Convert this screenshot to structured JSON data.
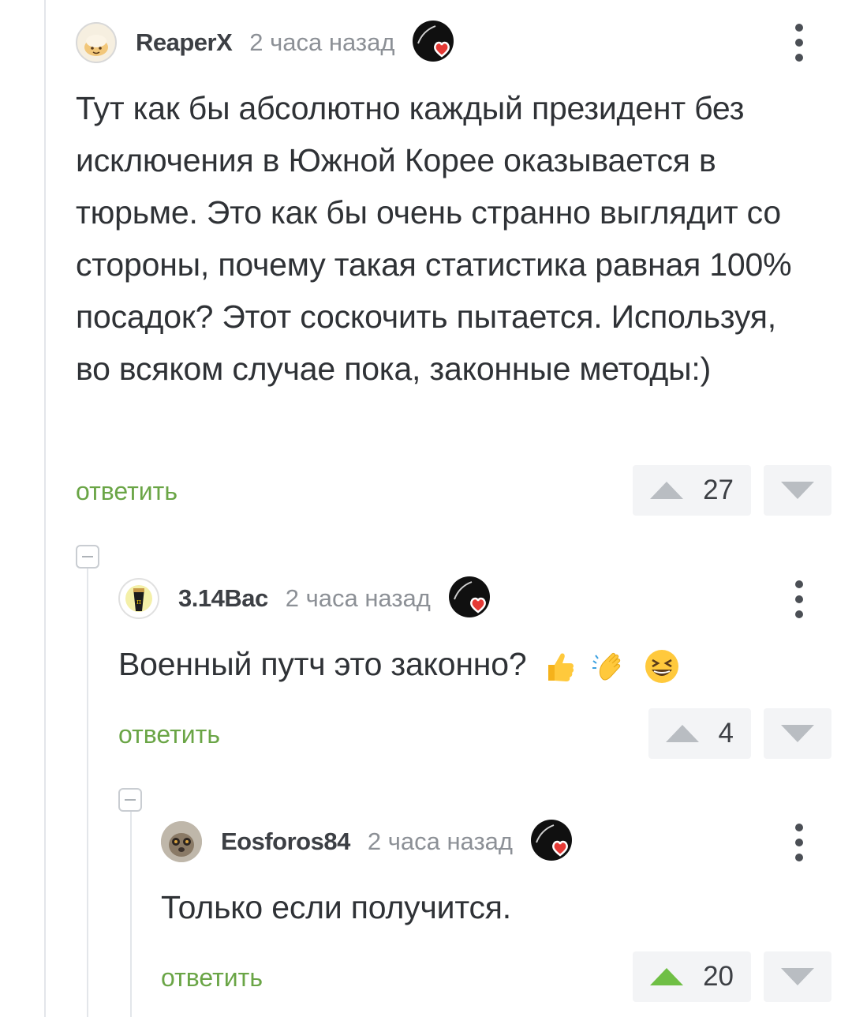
{
  "comments": [
    {
      "username": "ReaperX",
      "time": "2 часа назад",
      "avatar_icon": "pastry-avatar-icon",
      "text": "Тут как бы абсолютно каждый президент без исключения в Южной Корее оказывается в тюрьме. Это как бы очень странно выглядит со стороны, почему такая статистика равная 100% посадок? Этот соскочить пытается. Используя, во всяком случае пока, законные методы:)",
      "reply_label": "ответить",
      "votes": "27"
    },
    {
      "username": "3.14Bac",
      "time": "2 часа назад",
      "avatar_icon": "beer-glass-avatar-icon",
      "text": "Военный путч это законно?",
      "emojis": [
        "thumbs-up-emoji",
        "clapping-hands-emoji",
        "laughing-face-emoji"
      ],
      "reply_label": "ответить",
      "votes": "4"
    },
    {
      "username": "Eosforos84",
      "time": "2 часа назад",
      "avatar_icon": "lemur-avatar-icon",
      "text": "Только если получится.",
      "reply_label": "ответить",
      "votes": "20",
      "upvoted": true
    }
  ],
  "colors": {
    "reply_green": "#6aa546",
    "upvote_active": "#6fbf45",
    "heart_red": "#e53935"
  }
}
